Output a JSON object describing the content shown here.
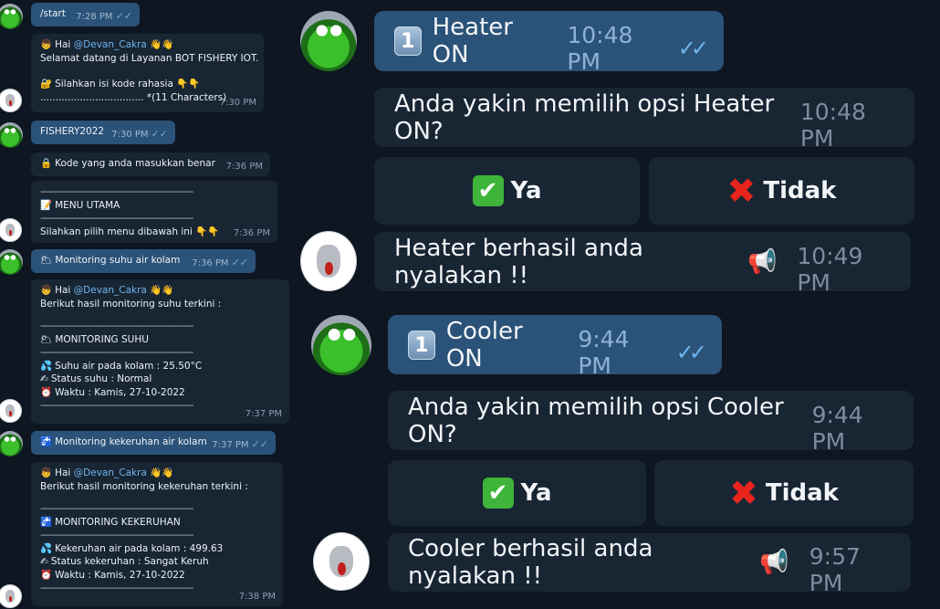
{
  "left": {
    "m1": {
      "text": "/start",
      "time": "7:28 PM",
      "check": "✓✓"
    },
    "m2": {
      "greet_icon": "👦",
      "greet": "Hai",
      "user": "@Devan_Cakra",
      "wave": "👋👋",
      "line2": "Selamat datang di Layanan BOT FISHERY IOT.",
      "lock_icon": "🔐",
      "line4": "Silahkan isi kode rahasia",
      "point": "👇👇",
      "line5": ".................................. *(11 Characters)",
      "time": "7:30 PM"
    },
    "m3": {
      "text": "FISHERY2022",
      "time": "7:30 PM",
      "check": "✓✓"
    },
    "m4": {
      "lock_icon": "🔒",
      "text": "Kode yang anda masukkan benar",
      "time": "7:36 PM"
    },
    "m5": {
      "dash": "------------------------------------------------------------",
      "menu_icon": "📝",
      "menu": "MENU UTAMA",
      "text": "Silahkan pilih menu dibawah ini",
      "point": "👇👇",
      "time": "7:36 PM"
    },
    "m6": {
      "icon": "🌥",
      "text": "Monitoring suhu air kolam",
      "time": "7:36 PM",
      "check": "✓✓"
    },
    "m7": {
      "greet_icon": "👦",
      "greet": "Hai",
      "user": "@Devan_Cakra",
      "wave": "👋👋",
      "line2": "Berikut hasil monitoring suhu terkini :",
      "dash": "------------------------------------------------------------",
      "title_icon": "🌥",
      "title": "MONITORING SUHU",
      "r1_icon": "💦",
      "r1": "Suhu air pada kolam : 25.50°C",
      "r2_icon": "✍",
      "r2": "Status suhu : Normal",
      "r3_icon": "⏰",
      "r3": "Waktu : Kamis, 27-10-2022",
      "time": "7:37 PM"
    },
    "m8": {
      "icon": "🚰",
      "text": "Monitoring kekeruhan air kolam",
      "time": "7:37 PM",
      "check": "✓✓"
    },
    "m9": {
      "greet_icon": "👦",
      "greet": "Hai",
      "user": "@Devan_Cakra",
      "wave": "👋👋",
      "line2": "Berikut hasil monitoring kekeruhan terkini :",
      "dash": "------------------------------------------------------------",
      "title_icon": "🚰",
      "title": "MONITORING KEKERUHAN",
      "r1_icon": "💦",
      "r1": "Kekeruhan air pada kolam : 499.63",
      "r2_icon": "✍",
      "r2": "Status kekeruhan : Sangat Keruh",
      "r3_icon": "⏰",
      "r3": "Waktu : Kamis, 27-10-2022",
      "time": "7:38 PM"
    }
  },
  "right": {
    "heater_cmd": {
      "key": "1",
      "text": "Heater ON",
      "time": "10:48 PM",
      "check": "✓✓"
    },
    "heater_q": {
      "text": "Anda yakin memilih opsi Heater ON?",
      "time": "10:48 PM"
    },
    "heater_yes": {
      "icon": "✔",
      "label": "Ya"
    },
    "heater_no": {
      "icon": "✖",
      "label": "Tidak"
    },
    "heater_done": {
      "text": "Heater berhasil anda nyalakan !!",
      "icon": "📢",
      "time": "10:49 PM"
    },
    "cooler_cmd": {
      "key": "1",
      "text": "Cooler ON",
      "time": "9:44 PM",
      "check": "✓✓"
    },
    "cooler_q": {
      "text": "Anda yakin memilih opsi Cooler ON?",
      "time": "9:44 PM"
    },
    "cooler_yes": {
      "icon": "✔",
      "label": "Ya"
    },
    "cooler_no": {
      "icon": "✖",
      "label": "Tidak"
    },
    "cooler_done": {
      "text": "Cooler berhasil anda nyalakan !!",
      "icon": "📢",
      "time": "9:57 PM"
    }
  }
}
